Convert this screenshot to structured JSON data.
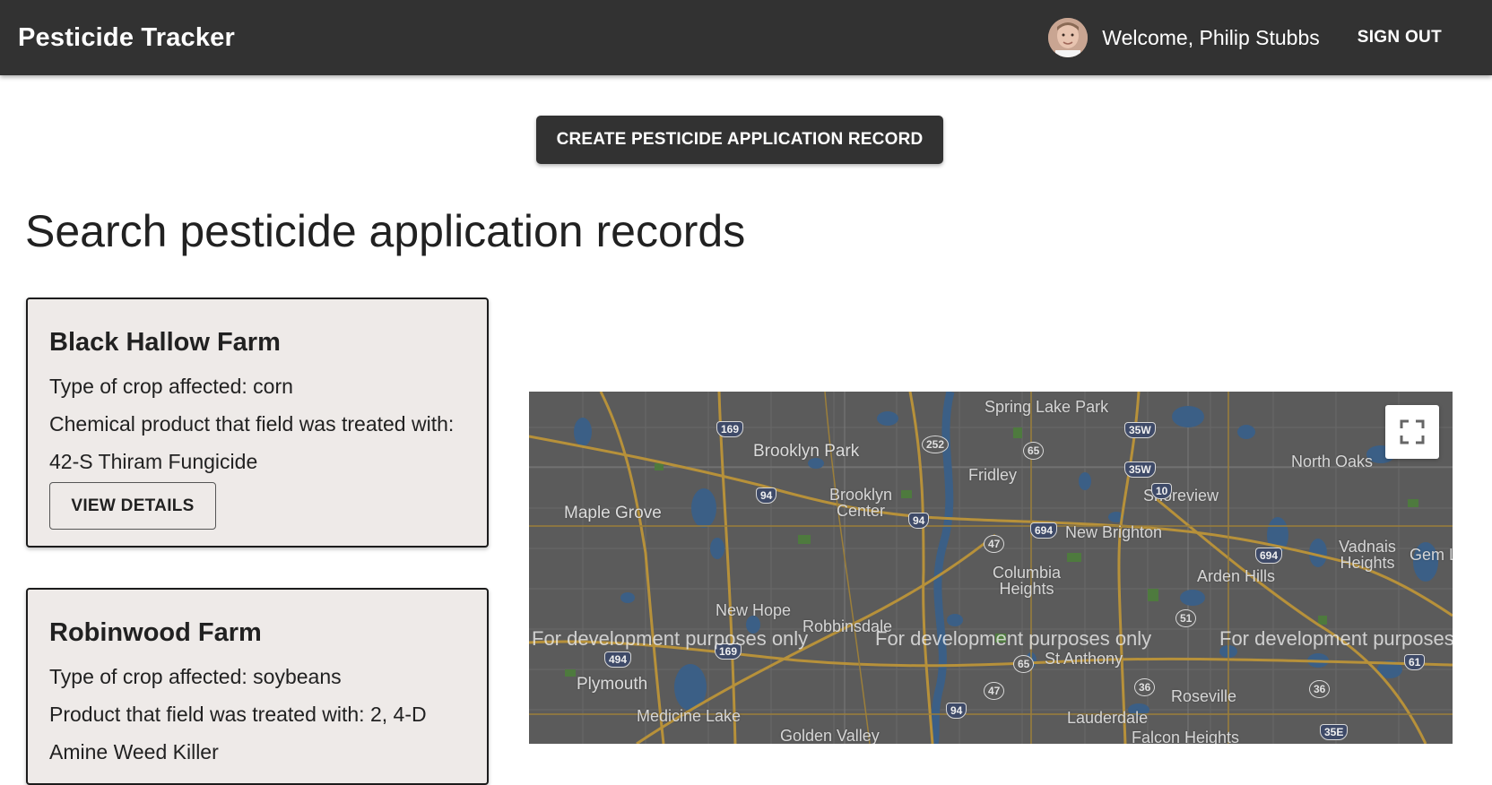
{
  "header": {
    "brand": "Pesticide Tracker",
    "welcome": "Welcome, Philip Stubbs",
    "sign_out": "SIGN OUT",
    "avatar_icon": "user-avatar-photo"
  },
  "actions": {
    "create_label": "CREATE PESTICIDE APPLICATION RECORD"
  },
  "page": {
    "title": "Search pesticide application records"
  },
  "records": [
    {
      "farm": "Black Hallow Farm",
      "crop_line": "Type of crop affected: corn",
      "product_line": "Chemical product that field was treated with:",
      "product_line2": "42-S Thiram Fungicide",
      "view_label": "VIEW DETAILS"
    },
    {
      "farm": "Robinwood Farm",
      "crop_line": "Type of crop affected: soybeans",
      "product_line": "Product that field was treated with: 2, 4-D",
      "product_line2": "Amine Weed Killer"
    }
  ],
  "map": {
    "dev_notice": "For development purposes only",
    "dev_notice_truncated": "For development purposes",
    "fullscreen_icon": "fullscreen-icon",
    "places": {
      "spring_lake_park": "Spring Lake Park",
      "brooklyn_park": "Brooklyn Park",
      "fridley": "Fridley",
      "north_oaks": "North Oaks",
      "maple_grove": "Maple Grove",
      "brooklyn_center": "Brooklyn Center",
      "shoreview": "Shoreview",
      "new_brighton": "New Brighton",
      "vadnais_heights": "Vadnais Heights",
      "gem_lake": "Gem L",
      "columbia_heights": "Columbia Heights",
      "arden_hills": "Arden Hills",
      "new_hope": "New Hope",
      "robbinsdale": "Robbinsdale",
      "st_anthony": "St Anthony",
      "plymouth": "Plymouth",
      "roseville": "Roseville",
      "medicine_lake": "Medicine Lake",
      "lauderdale": "Lauderdale",
      "golden_valley": "Golden Valley",
      "falcon_heights": "Falcon Heights"
    },
    "shields": {
      "us169a": "169",
      "mn252": "252",
      "mn65a": "65",
      "i35w_a": "35W",
      "i35w_b": "35W",
      "i94a": "94",
      "i94b": "94",
      "us10": "10",
      "i694a": "694",
      "i694b": "694",
      "mn47a": "47",
      "mn51": "51",
      "i494": "494",
      "us169b": "169",
      "mn65b": "65",
      "mn47b": "47",
      "mn36a": "36",
      "mn36b": "36",
      "mn61": "61",
      "i94c": "94",
      "i35e": "35E"
    }
  }
}
